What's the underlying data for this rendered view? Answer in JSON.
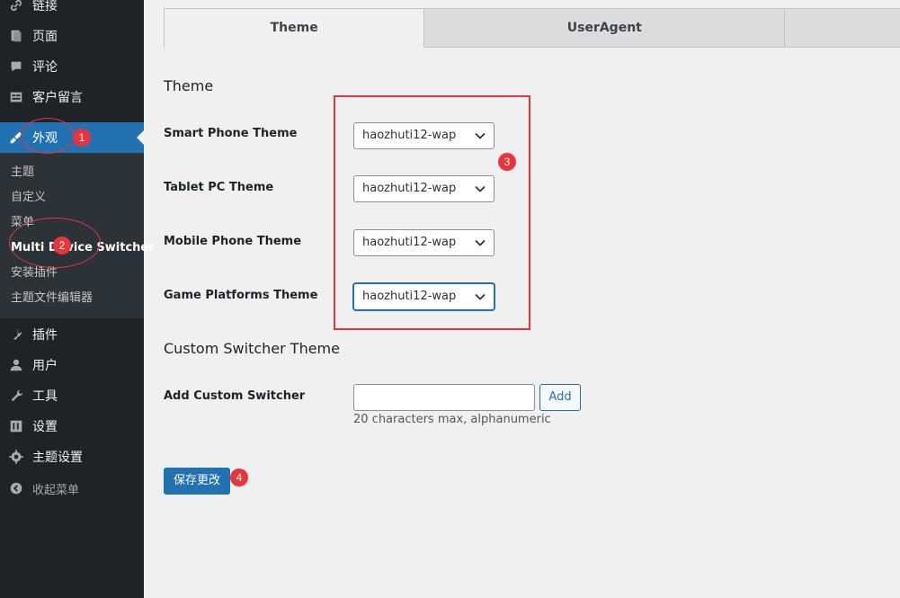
{
  "sidebar": {
    "items": [
      {
        "label": "链接",
        "icon": "link-icon"
      },
      {
        "label": "页面",
        "icon": "pages-icon"
      },
      {
        "label": "评论",
        "icon": "comments-icon"
      },
      {
        "label": "客户留言",
        "icon": "guestbook-icon"
      },
      {
        "label": "外观",
        "icon": "appearance-icon",
        "active": true
      },
      {
        "label": "插件",
        "icon": "plugins-icon"
      },
      {
        "label": "用户",
        "icon": "users-icon"
      },
      {
        "label": "工具",
        "icon": "tools-icon"
      },
      {
        "label": "设置",
        "icon": "settings-icon"
      },
      {
        "label": "主题设置",
        "icon": "gear-icon"
      }
    ],
    "submenu": [
      "主题",
      "自定义",
      "菜单",
      "Multi Device Switcher",
      "安装插件",
      "主题文件编辑器"
    ],
    "collapse_label": "收起菜单"
  },
  "tabs": [
    {
      "label": "Theme",
      "active": true
    },
    {
      "label": "UserAgent",
      "active": false
    },
    {
      "label": "",
      "active": false
    }
  ],
  "theme_section": {
    "heading": "Theme",
    "rows": [
      {
        "label": "Smart Phone Theme",
        "value": "haozhuti12-wap"
      },
      {
        "label": "Tablet PC Theme",
        "value": "haozhuti12-wap"
      },
      {
        "label": "Mobile Phone Theme",
        "value": "haozhuti12-wap"
      },
      {
        "label": "Game Platforms Theme",
        "value": "haozhuti12-wap"
      }
    ]
  },
  "custom_section": {
    "heading": "Custom Switcher Theme",
    "label": "Add Custom Switcher",
    "input_value": "",
    "add_label": "Add",
    "hint": "20 characters max, alphanumeric"
  },
  "save_label": "保存更改",
  "annotations": [
    "1",
    "2",
    "3",
    "4"
  ],
  "colors": {
    "accent": "#2271b1",
    "annotation": "#e8343b",
    "sidebar": "#1d2327"
  }
}
